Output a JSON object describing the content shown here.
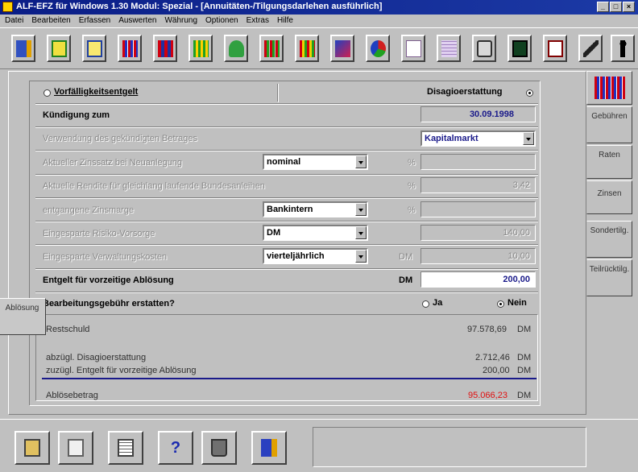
{
  "window": {
    "title": "ALF-EFZ für Windows 1.30 Modul: Spezial - [Annuitäten-/Tilgungsdarlehen ausführlich]",
    "min": "_",
    "max": "□",
    "close": "×"
  },
  "menu": [
    "Datei",
    "Bearbeiten",
    "Erfassen",
    "Auswerten",
    "Währung",
    "Optionen",
    "Extras",
    "Hilfe"
  ],
  "toolbar_icons": [
    "exit-door-icon",
    "open-folder-icon",
    "print-preview-icon",
    "bar-chart-icon",
    "bar-chart-red-icon",
    "bar-chart-green-icon",
    "money-bag-icon",
    "bar-chart-mixed-icon",
    "bar-chart-multi-icon",
    "chart-3d-icon",
    "pie-chart-icon",
    "line-chart-icon",
    "table-chart-icon",
    "printer-icon",
    "calculator-icon",
    "currency-icon",
    "brush-icon",
    "person-icon"
  ],
  "form": {
    "vorfaelligkeit_label": "Vorfälligkeitsentgelt",
    "disagio_label": "Disagioerstattung",
    "kuendigung_label": "Kündigung zum",
    "kuendigung_value": "30.09.1998",
    "verwendung_label": "Verwendung des gekündigten Betrages",
    "verwendung_value": "Kapitalmarkt",
    "zinssatz_label": "Aktueller Zinssatz bei Neuanlegung",
    "zinssatz_combo": "nominal",
    "zinssatz_unit": "%",
    "zinssatz_value": "",
    "rendite_label": "Aktuelle Rendite für gleichlang laufende Bundesanleihen",
    "rendite_unit": "%",
    "rendite_value": "3,42",
    "zinsmarge_label": "entgangene Zinsmarge",
    "zinsmarge_combo": "Bankintern",
    "zinsmarge_unit": "%",
    "zinsmarge_value": "",
    "risiko_label": "Eingesparte Risiko-Vorsorge",
    "risiko_combo": "DM",
    "risiko_value": "140,00",
    "verwaltung_label": "Eingesparte Verwaltungskosten",
    "verwaltung_combo": "vierteljährlich",
    "verwaltung_unit": "DM",
    "verwaltung_value": "10,00",
    "entgelt_label": "Entgelt für vorzeitige Ablösung",
    "entgelt_unit": "DM",
    "entgelt_value": "200,00",
    "gebuehr_label": "Bearbeitungsgebühr erstatten?",
    "ja_label": "Ja",
    "nein_label": "Nein",
    "restschuld_label": "Restschuld",
    "restschuld_value": "97.578,69",
    "restschuld_unit": "DM",
    "abzgl_label": "abzügl. Disagioerstattung",
    "abzgl_value": "2.712,46",
    "abzgl_unit": "DM",
    "zuzgl_label": "zuzügl. Entgelt für vorzeitige Ablösung",
    "zuzgl_value": "200,00",
    "zuzgl_unit": "DM",
    "abloese_label": "Ablösebetrag",
    "abloese_value": "95.066,23",
    "abloese_unit": "DM"
  },
  "side_tabs": [
    {
      "label": ""
    },
    {
      "label": "Gebühren"
    },
    {
      "label": "Raten"
    },
    {
      "label": "Zinsen"
    },
    {
      "label": "Sondertilg."
    },
    {
      "label": "Teilrücktilg."
    },
    {
      "label": "Ablösung"
    }
  ],
  "bottom_icons": [
    "calculator-icon",
    "document-icon",
    "form-icon",
    "help-icon",
    "trash-icon",
    "exit-icon"
  ],
  "help_glyph": "?",
  "colors": {
    "total_red": "#e01010",
    "value_blue": "#1a1a8a",
    "title_blue": "#0a1d86"
  }
}
